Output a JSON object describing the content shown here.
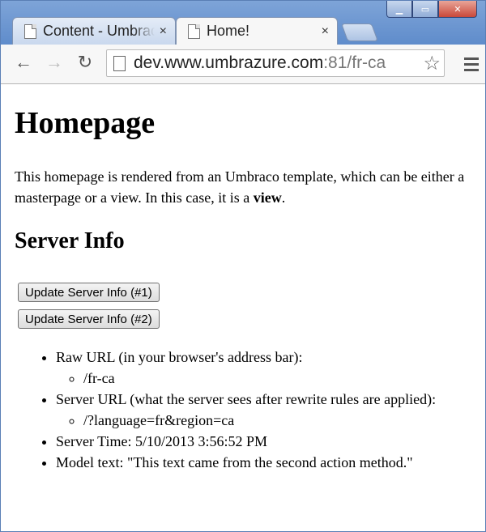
{
  "browser": {
    "tabs": [
      {
        "label": "Content - Umbraco",
        "close": "×",
        "active": false
      },
      {
        "label": "Home!",
        "close": "×",
        "active": true
      }
    ],
    "window_controls": {
      "minimize": "▁",
      "maximize": "▭",
      "close": "✕"
    },
    "address_bar": {
      "host": "dev.www.umbrazure.com",
      "rest": ":81/fr-ca"
    },
    "nav": {
      "back": "←",
      "forward": "→",
      "reload": "↻"
    },
    "star": "☆"
  },
  "page": {
    "title": "Homepage",
    "intro_text": "This homepage is rendered from an Umbraco template, which can be either a masterpage or a view. In this case, it is a ",
    "intro_bold": "view",
    "intro_end": ".",
    "section_title": "Server Info",
    "buttons": {
      "update1": "Update Server Info (#1)",
      "update2": "Update Server Info (#2)"
    },
    "info": {
      "raw_url_label": "Raw URL (in your browser's address bar):",
      "raw_url_value": "/fr-ca",
      "server_url_label": "Server URL (what the server sees after rewrite rules are applied):",
      "server_url_value": "/?language=fr&region=ca",
      "server_time": "Server Time: 5/10/2013 3:56:52 PM",
      "model_text": "Model text: \"This text came from the second action method.\""
    }
  },
  "colors": {
    "titlebar": "#6f98d2",
    "toolbar": "#f7f7f7"
  }
}
